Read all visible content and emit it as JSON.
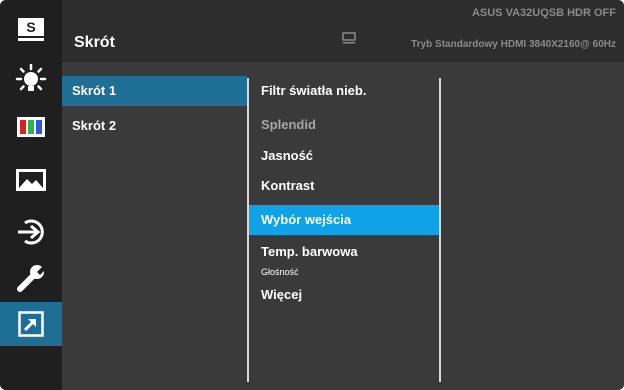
{
  "header": {
    "title": "Skrót",
    "model": "ASUS  VA32UQSB HDR OFF",
    "status": "Tryb Standardowy HDMI 3840X2160@ 60Hz"
  },
  "sidebar": {
    "items": [
      {
        "name": "splendid",
        "label": "S",
        "icon": "splendid-s-icon"
      },
      {
        "name": "blue-light",
        "icon": "sun-bulb-icon"
      },
      {
        "name": "color",
        "icon": "color-bars-icon"
      },
      {
        "name": "image",
        "icon": "picture-icon"
      },
      {
        "name": "input-select",
        "icon": "input-arrow-icon"
      },
      {
        "name": "system-setup",
        "icon": "wrench-icon"
      },
      {
        "name": "shortcut",
        "icon": "shortcut-arrow-icon",
        "active": true
      }
    ]
  },
  "menu": {
    "items": [
      {
        "label": "Skrót 1",
        "selected": true
      },
      {
        "label": "Skrót 2"
      }
    ]
  },
  "submenu": {
    "items": [
      {
        "label": "Filtr światła nieb."
      },
      {
        "label": "Splendid",
        "dim": true
      },
      {
        "label": "Jasność"
      },
      {
        "label": "Kontrast"
      },
      {
        "label": "Wybór wejścia",
        "highlighted": true
      },
      {
        "label": "Temp. barwowa"
      },
      {
        "label": "Głośność",
        "small": true
      },
      {
        "label": "Więcej"
      }
    ]
  },
  "colors": {
    "accent": "#1e6e96",
    "highlight": "#0fa2e6",
    "background": "#3a3a3a",
    "sidebar": "#1f1f1f"
  }
}
